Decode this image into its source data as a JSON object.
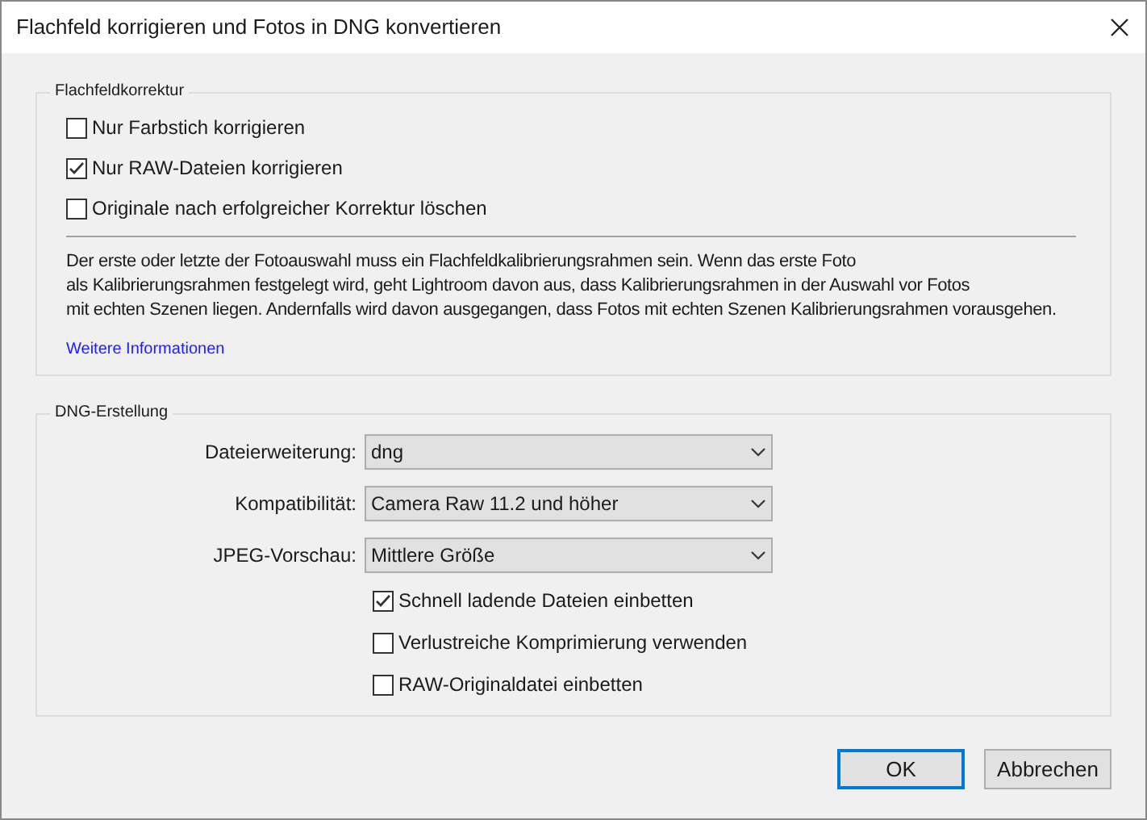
{
  "window": {
    "title": "Flachfeld korrigieren und Fotos in DNG konvertieren"
  },
  "flatfield": {
    "legend": "Flachfeldkorrektur",
    "options": [
      {
        "label": "Nur Farbstich korrigieren",
        "checked": false
      },
      {
        "label": "Nur RAW-Dateien korrigieren",
        "checked": true
      },
      {
        "label": "Originale nach erfolgreicher Korrektur löschen",
        "checked": false
      }
    ],
    "description_lines": [
      "Der erste oder letzte der Fotoauswahl muss ein Flachfeldkalibrierungsrahmen sein. Wenn das erste Foto",
      "als Kalibrierungsrahmen festgelegt wird, geht Lightroom davon aus, dass Kalibrierungsrahmen in der Auswahl vor Fotos",
      "mit echten Szenen liegen. Andernfalls wird davon ausgegangen, dass Fotos mit echten Szenen Kalibrierungsrahmen vorausgehen."
    ],
    "link": "Weitere Informationen"
  },
  "dng": {
    "legend": "DNG-Erstellung",
    "selects": [
      {
        "label": "Dateierweiterung:",
        "value": "dng"
      },
      {
        "label": "Kompatibilität:",
        "value": "Camera Raw 11.2 und höher"
      },
      {
        "label": "JPEG-Vorschau:",
        "value": "Mittlere Größe"
      }
    ],
    "options": [
      {
        "label": "Schnell ladende Dateien einbetten",
        "checked": true
      },
      {
        "label": "Verlustreiche Komprimierung verwenden",
        "checked": false
      },
      {
        "label": "RAW-Originaldatei einbetten",
        "checked": false
      }
    ]
  },
  "buttons": [
    {
      "label": "OK",
      "default": true
    },
    {
      "label": "Abbrechen",
      "default": false
    }
  ]
}
